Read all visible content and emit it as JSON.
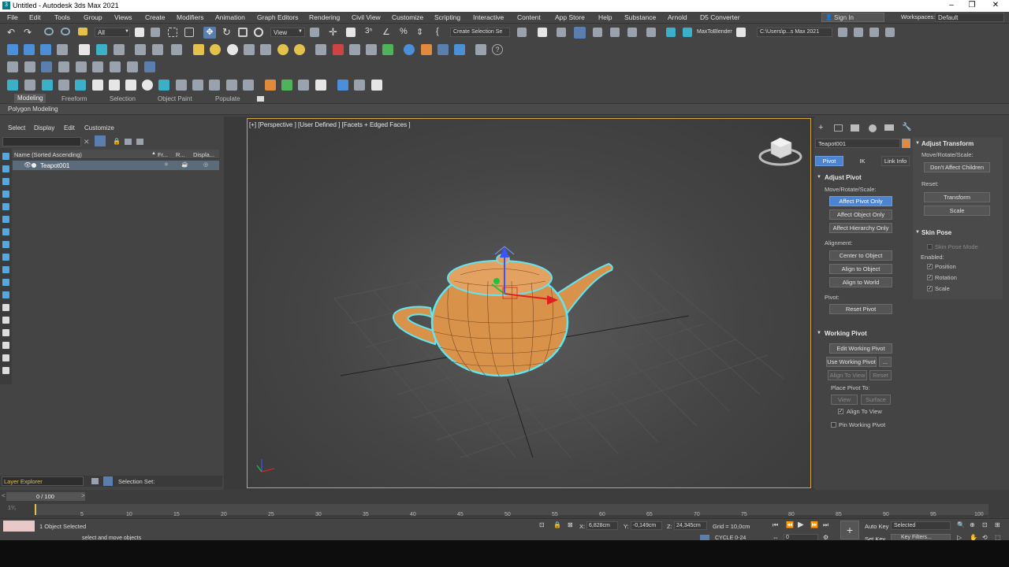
{
  "titlebar": {
    "title": "Untitled - Autodesk 3ds Max 2021",
    "minimize": "–",
    "restore": "❐",
    "close": "✕"
  },
  "menu": [
    "File",
    "Edit",
    "Tools",
    "Group",
    "Views",
    "Create",
    "Modifiers",
    "Animation",
    "Graph Editors",
    "Rendering",
    "Civil View",
    "Customize",
    "Scripting",
    "Interactive",
    "Content",
    "App Store",
    "Help",
    "Substance",
    "Arnold",
    "D5 Converter"
  ],
  "account": {
    "signin": "Sign In",
    "workspaces_label": "Workspaces:",
    "workspace": "Default"
  },
  "toolbar": {
    "filter": "All",
    "view": "View",
    "create_selection": "Create Selection Se",
    "max_to_blender": "MaxToBlender",
    "path": "C:\\Users\\p...s Max 2021"
  },
  "ribbon": {
    "tabs": [
      "Modeling",
      "Freeform",
      "Selection",
      "Object Paint",
      "Populate"
    ],
    "active": "Modeling",
    "sub": "Polygon Modeling"
  },
  "scene_explorer": {
    "menu": [
      "Select",
      "Display",
      "Edit",
      "Customize"
    ],
    "columns": [
      "Name (Sorted Ascending)",
      "Fr...",
      "R...",
      "Displa..."
    ],
    "objects": [
      {
        "name": "Teapot001"
      }
    ],
    "layer_explorer": "Layer Explorer",
    "selection_set": "Selection Set:"
  },
  "viewport": {
    "label": "[+] [Perspective ] [User Defined ] [Facets + Edged Faces ]"
  },
  "command_panel": {
    "object_name": "Teapot001",
    "object_color": "#e38a3f",
    "tabs": [
      "Pivot",
      "IK",
      "Link Info"
    ],
    "active_tab": "Pivot",
    "adjust_pivot": {
      "title": "Adjust Pivot",
      "move_label": "Move/Rotate/Scale:",
      "buttons": [
        "Affect Pivot Only",
        "Affect Object Only",
        "Affect Hierarchy Only"
      ],
      "active": "Affect Pivot Only",
      "alignment_label": "Alignment:",
      "align_buttons": [
        "Center to Object",
        "Align to Object",
        "Align to World"
      ],
      "pivot_label": "Pivot:",
      "reset_pivot": "Reset Pivot"
    },
    "working_pivot": {
      "title": "Working Pivot",
      "edit": "Edit Working Pivot",
      "use": "Use Working Pivot",
      "use_more": "...",
      "align_to_view": "Align To View",
      "reset": "Reset",
      "place_label": "Place Pivot To:",
      "view": "View",
      "surface": "Surface",
      "align_to_view_chk": "Align To View",
      "pin": "Pin Working Pivot"
    }
  },
  "adjust_transform": {
    "title": "Adjust Transform",
    "move_label": "Move/Rotate/Scale:",
    "dont_affect": "Don't Affect Children",
    "reset_label": "Reset:",
    "transform": "Transform",
    "scale": "Scale"
  },
  "skin_pose": {
    "title": "Skin Pose",
    "mode": "Skin Pose Mode",
    "enabled_label": "Enabled:",
    "position": "Position",
    "rotation": "Rotation",
    "scale": "Scale"
  },
  "timeline": {
    "frame": "0 / 100",
    "ticks": [
      "5",
      "10",
      "15",
      "20",
      "25",
      "30",
      "35",
      "40",
      "45",
      "50",
      "55",
      "60",
      "65",
      "70",
      "75",
      "80",
      "85",
      "90",
      "95",
      "100"
    ]
  },
  "status": {
    "selected": "1 Object Selected",
    "prompt": "select and move objects",
    "x": "6,828cm",
    "y": "-0,149cm",
    "z": "24,345cm",
    "grid": "Grid = 10,0cm",
    "cycle": "CYCLE 0-24",
    "auto_key": "Auto Key",
    "set_key": "Set Key",
    "selected_dd": "Selected",
    "key_filters": "Key Filters...",
    "frame_field": "0"
  }
}
